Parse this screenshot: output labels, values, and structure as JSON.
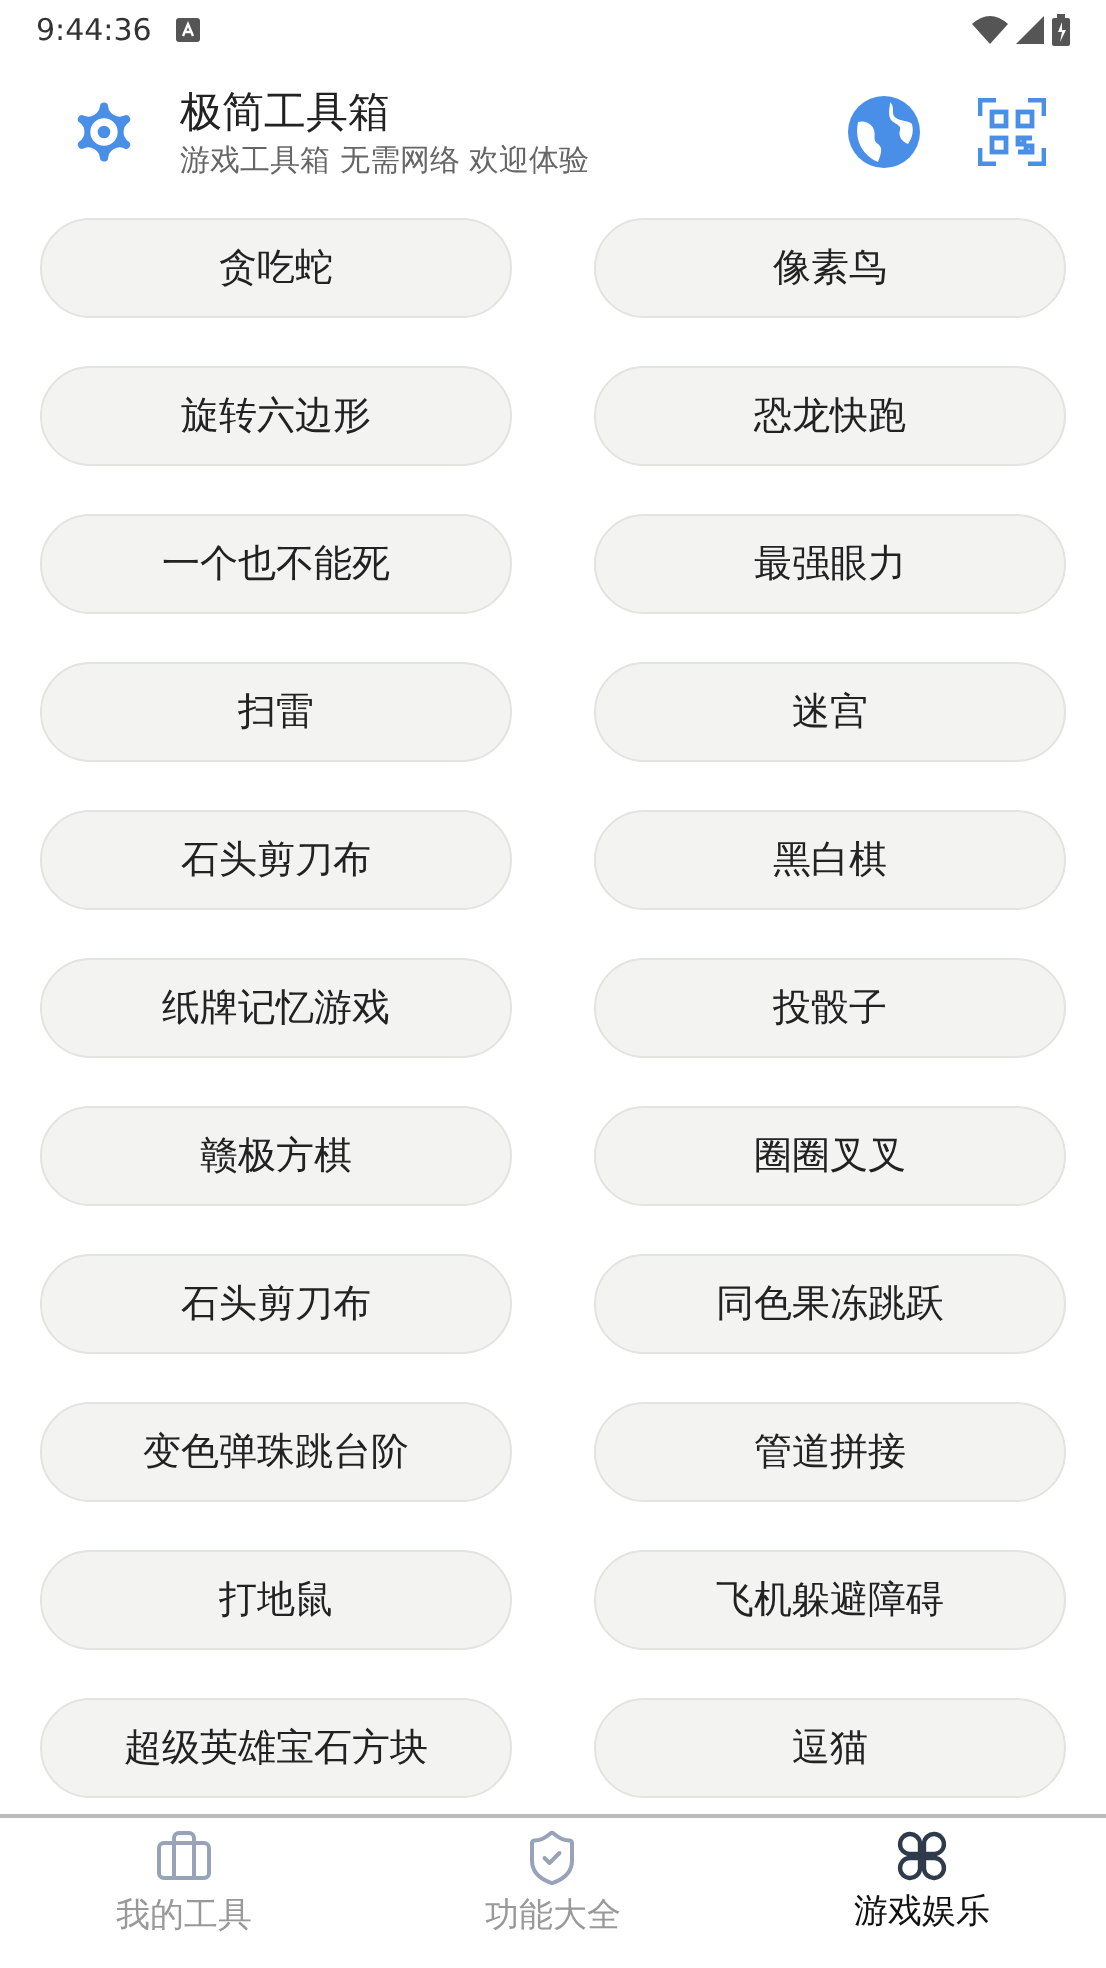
{
  "status_bar": {
    "time": "9:44:36"
  },
  "header": {
    "title": "极简工具箱",
    "subtitle": "游戏工具箱 无需网络 欢迎体验"
  },
  "games": [
    "贪吃蛇",
    "像素鸟",
    "旋转六边形",
    "恐龙快跑",
    "一个也不能死",
    "最强眼力",
    "扫雷",
    "迷宫",
    "石头剪刀布",
    "黑白棋",
    "纸牌记忆游戏",
    "投骰子",
    "赣极方棋",
    "圈圈叉叉",
    "石头剪刀布",
    "同色果冻跳跃",
    "变色弹珠跳台阶",
    "管道拼接",
    "打地鼠",
    "飞机躲避障碍",
    "超级英雄宝石方块",
    "逗猫"
  ],
  "bottom_nav": [
    {
      "kind": "tools",
      "label": "我的工具",
      "selected": false
    },
    {
      "kind": "features",
      "label": "功能大全",
      "selected": false
    },
    {
      "kind": "games",
      "label": "游戏娱乐",
      "selected": true
    }
  ]
}
